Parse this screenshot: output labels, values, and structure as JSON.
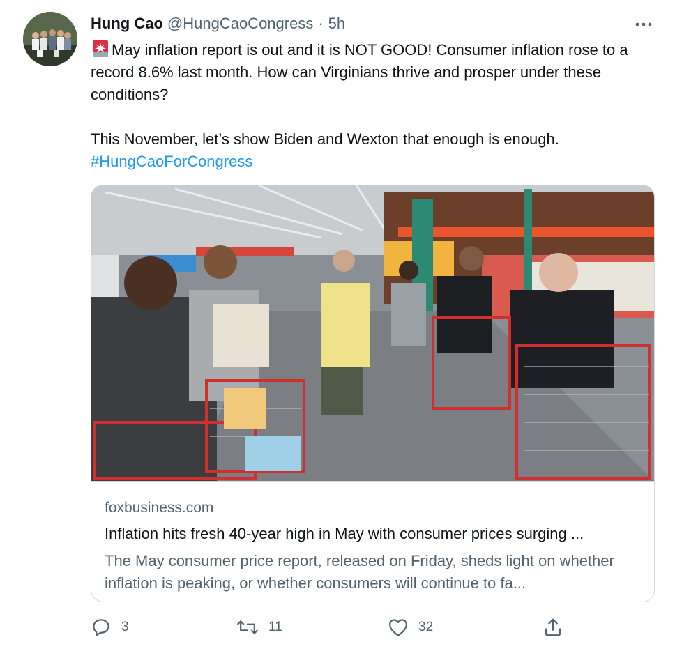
{
  "tweet": {
    "author_name": "Hung Cao",
    "handle": "@HungCaoCongress",
    "separator": "·",
    "time": "5h",
    "text_para1": "May inflation report is out and it is NOT GOOD! Consumer inflation rose to a record 8.6% last month. How can Virginians thrive and prosper under these conditions?",
    "text_para2": "This November, let’s show Biden and Wexton that enough is enough.",
    "hashtag": "#HungCaoForCongress",
    "emoji_icon": "rotating-light-icon"
  },
  "card": {
    "domain": "foxbusiness.com",
    "title": "Inflation hits fresh 40-year high in May with consumer prices surging ...",
    "description": "The May consumer price report, released on Friday, sheds light on whether inflation is peaking, or whether consumers will continue to fa..."
  },
  "actions": {
    "reply_count": "3",
    "retweet_count": "11",
    "like_count": "32"
  },
  "colors": {
    "text": "#0f1419",
    "secondary": "#536471",
    "link": "#1d9bf0",
    "border": "#cfd9de"
  }
}
